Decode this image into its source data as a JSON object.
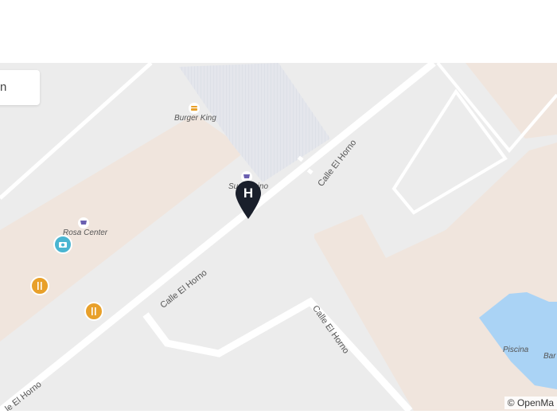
{
  "search": {
    "partial_text": "n"
  },
  "pois": {
    "burger_king": "Burger King",
    "super_dino": "Super Dino",
    "rosa_center": "Rosa Center",
    "piscina": "Piscina",
    "bar": "Bar"
  },
  "streets": {
    "upper": "Calle El Horno",
    "middle": "Calle El Horno",
    "right": "Calle El Horno",
    "bottom": "le El Horno"
  },
  "marker": {
    "label": "H"
  },
  "attribution": "© OpenMa",
  "icons": {
    "burger": "fast-food-icon",
    "cart": "shopping-cart-icon",
    "camera": "camera-icon",
    "restaurant": "fork-knife-icon",
    "hotel": "hotel-pin-icon"
  },
  "colors": {
    "map_background": "#ececec",
    "building": "#f0e5dd",
    "road": "#ffffff",
    "water": "#aad3f5",
    "restaurant_icon": "#e8a02a",
    "camera_icon": "#4ab5d1",
    "marker": "#1a1f2b"
  }
}
